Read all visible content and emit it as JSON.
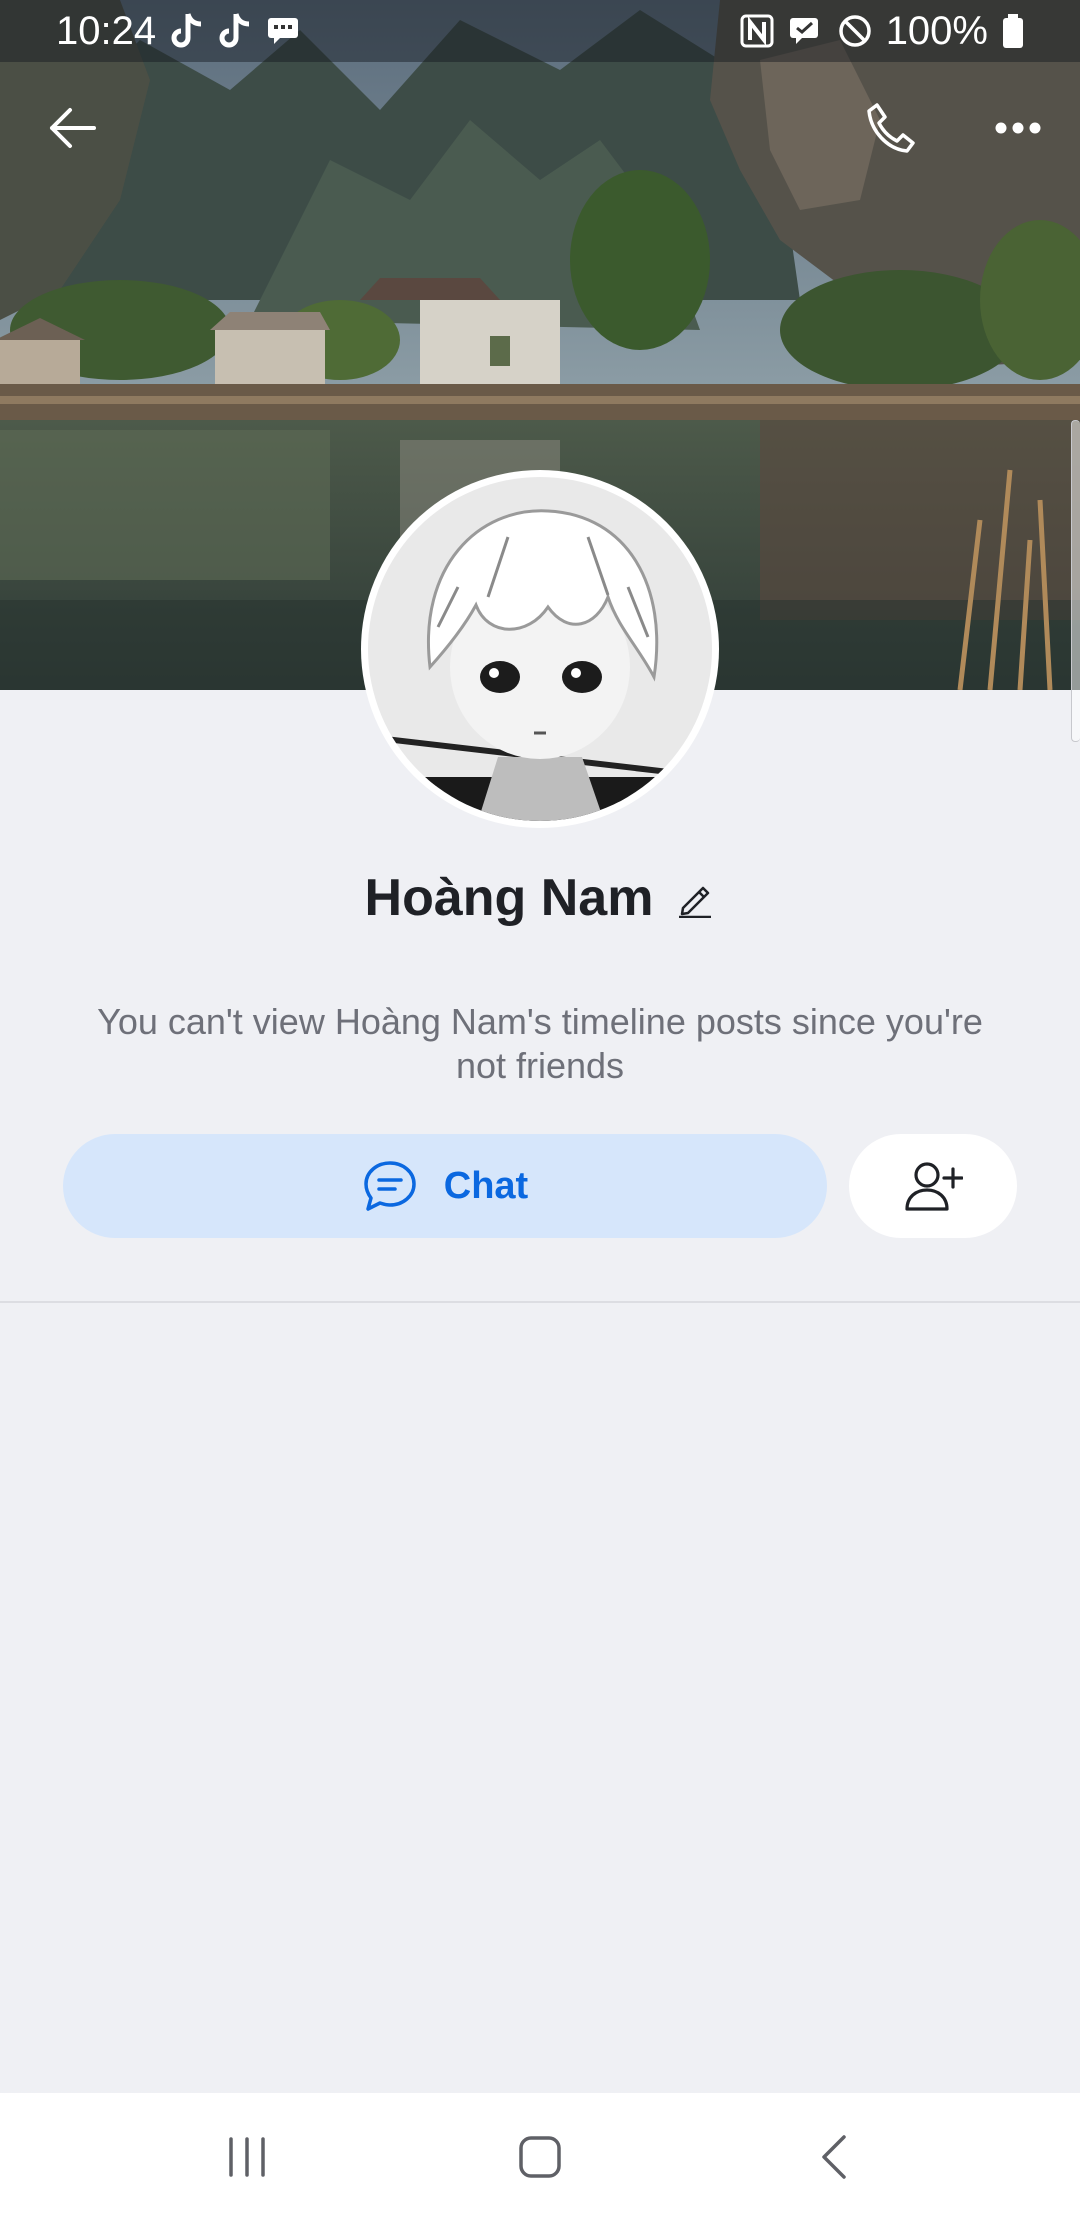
{
  "status_bar": {
    "time": "10:24",
    "battery": "100%",
    "left_icons": [
      "tiktok-icon",
      "tiktok-icon",
      "message-notification-icon"
    ],
    "right_icons": [
      "nfc-icon",
      "rcs-icon",
      "do-not-disturb-icon",
      "battery-icon"
    ]
  },
  "header": {
    "back_icon": "arrow-left-icon",
    "call_icon": "phone-icon",
    "more_icon": "more-horizontal-icon"
  },
  "profile": {
    "name": "Hoàng Nam",
    "edit_icon": "pencil-icon",
    "notice": "You can't view Hoàng Nam's timeline posts since you're not friends"
  },
  "actions": {
    "chat_label": "Chat",
    "chat_icon": "chat-bubble-icon",
    "add_friend_icon": "add-friend-icon"
  },
  "system_nav": {
    "recents_icon": "recents-icon",
    "home_icon": "home-icon",
    "back_icon": "back-chevron-icon"
  },
  "colors": {
    "background": "#eff0f4",
    "accent": "#0b68e0",
    "chat_button_bg": "#d6e6fb",
    "name_text": "#1f2126",
    "notice_text": "#6e7079"
  }
}
